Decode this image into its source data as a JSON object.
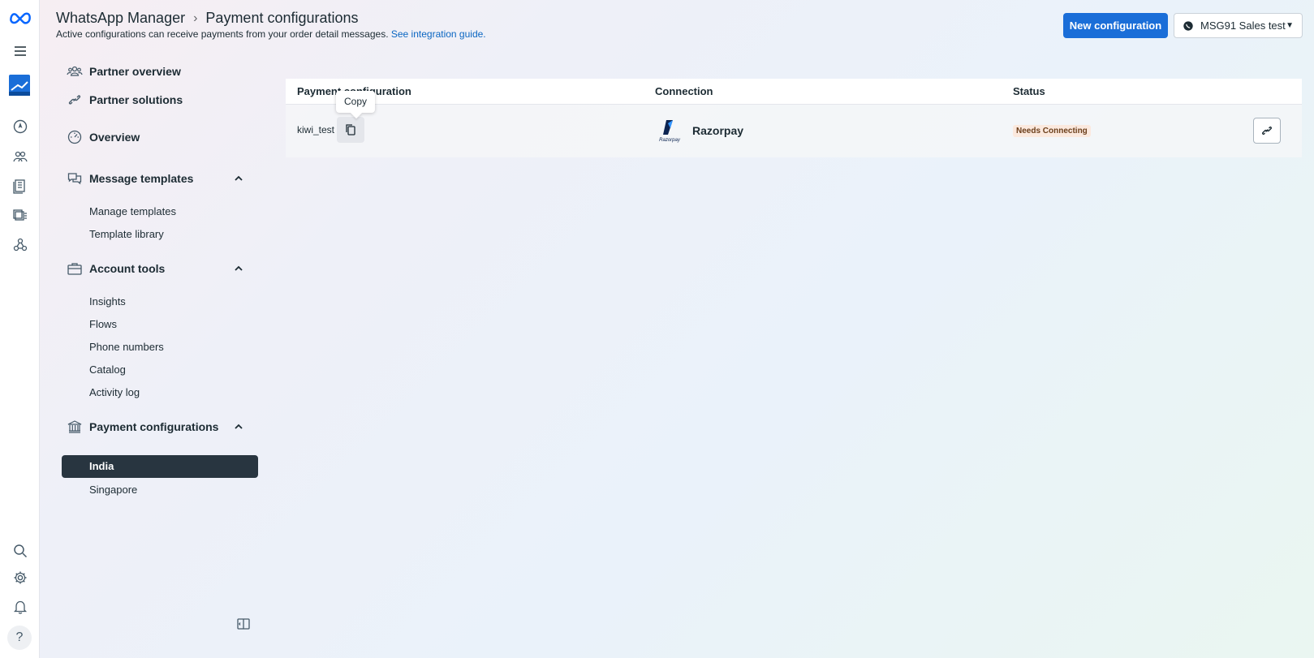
{
  "header": {
    "app": "WhatsApp Manager",
    "page": "Payment configurations",
    "subtitle": "Active configurations can receive payments from your order detail messages.",
    "guide_link": "See integration guide."
  },
  "actions": {
    "new_config": "New configuration",
    "account": "MSG91 Sales test"
  },
  "sidebar": {
    "partner_overview": "Partner overview",
    "partner_solutions": "Partner solutions",
    "overview": "Overview",
    "message_templates": "Message templates",
    "manage_templates": "Manage templates",
    "template_library": "Template library",
    "account_tools": "Account tools",
    "insights": "Insights",
    "flows": "Flows",
    "phone_numbers": "Phone numbers",
    "catalog": "Catalog",
    "activity_log": "Activity log",
    "payment_configurations": "Payment configurations",
    "india": "India",
    "singapore": "Singapore"
  },
  "table": {
    "col_config": "Payment configuration",
    "col_connection": "Connection",
    "col_status": "Status",
    "rows": [
      {
        "name": "kiwi_test",
        "provider": "Razorpay",
        "provider_logo_text": "Razorpay",
        "status": "Needs Connecting"
      }
    ]
  },
  "tooltip": "Copy",
  "rail_help": "?",
  "colors": {
    "primary": "#1a6ed8",
    "active_nav": "#283540",
    "status_bg": "#fbe9de"
  }
}
